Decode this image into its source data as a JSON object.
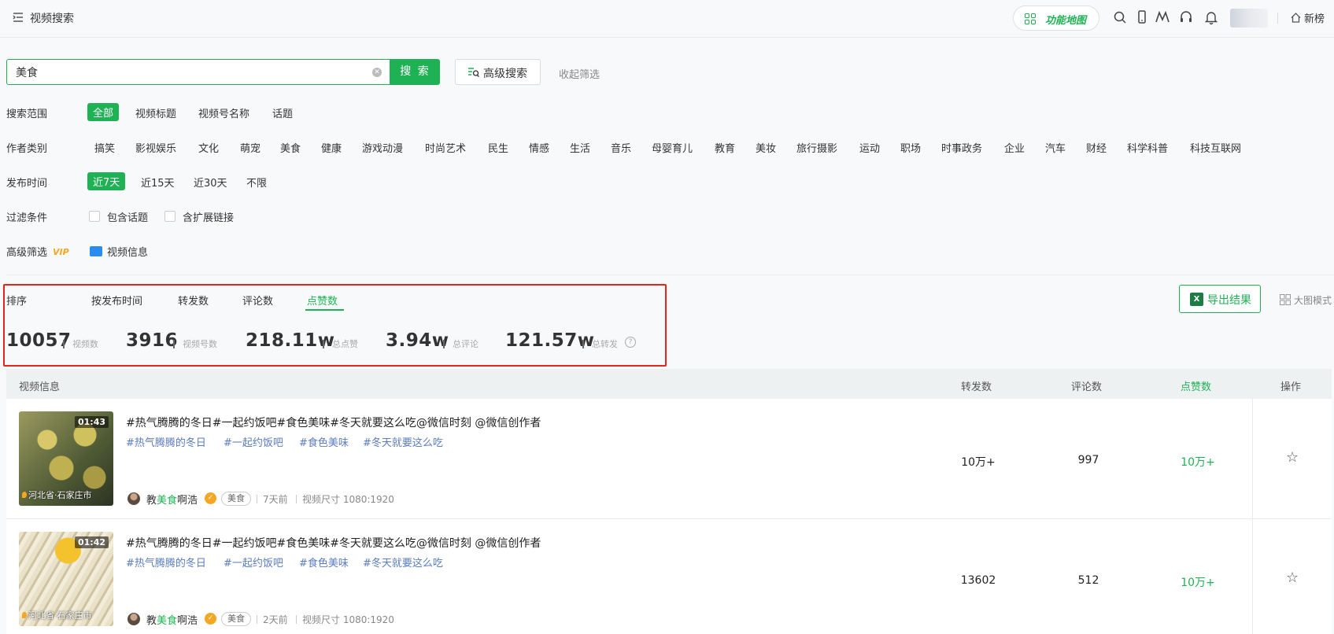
{
  "header": {
    "title": "视频搜索",
    "func_map": "功能地图",
    "xinbang": "新榜",
    "icons": [
      "search-icon",
      "mobile-icon",
      "chart-logo-icon",
      "headset-icon",
      "bell-icon"
    ]
  },
  "search": {
    "value": "美食",
    "button": "搜 索",
    "advanced": "高级搜索",
    "collapse": "收起筛选"
  },
  "filters": {
    "scope": {
      "label": "搜索范围",
      "options": [
        "全部",
        "视频标题",
        "视频号名称",
        "话题"
      ],
      "active": "全部"
    },
    "author": {
      "label": "作者类别",
      "options": [
        "搞笑",
        "影视娱乐",
        "文化",
        "萌宠",
        "美食",
        "健康",
        "游戏动漫",
        "时尚艺术",
        "民生",
        "情感",
        "生活",
        "音乐",
        "母婴育儿",
        "教育",
        "美妆",
        "旅行摄影",
        "运动",
        "职场",
        "时事政务",
        "企业",
        "汽车",
        "财经",
        "科学科普",
        "科技互联网"
      ]
    },
    "time": {
      "label": "发布时间",
      "options": [
        "近7天",
        "近15天",
        "近30天",
        "不限"
      ],
      "active": "近7天"
    },
    "condition": {
      "label": "过滤条件",
      "options": [
        "包含话题",
        "含扩展链接"
      ]
    },
    "advanced": {
      "label": "高级筛选",
      "vip": "VIP",
      "video_info": "视频信息"
    }
  },
  "sort": {
    "label": "排序",
    "tabs": [
      "按发布时间",
      "转发数",
      "评论数",
      "点赞数"
    ],
    "active": "点赞数"
  },
  "stats": [
    {
      "value": "10057",
      "label": "视频数"
    },
    {
      "value": "3916",
      "label": "视频号数"
    },
    {
      "value": "218.11w",
      "label": "总点赞"
    },
    {
      "value": "3.94w",
      "label": "总评论"
    },
    {
      "value": "121.57w",
      "label": "总转发"
    }
  ],
  "export": "导出结果",
  "big_mode": "大图模式",
  "table": {
    "headers": {
      "info": "视频信息",
      "share": "转发数",
      "comment": "评论数",
      "like": "点赞数",
      "action": "操作"
    },
    "rows": [
      {
        "duration": "01:43",
        "location": "河北省·石家庄市",
        "title": "#热气腾腾的冬日#一起约饭吧#食色美味#冬天就要这么吃@微信时刻 @微信创作者",
        "tags": [
          "#热气腾腾的冬日",
          "#一起约饭吧",
          "#食色美味",
          "#冬天就要这么吃"
        ],
        "author_pre": "教",
        "author_hl": "美食",
        "author_post": "啊浩",
        "category": "美食",
        "time": "7天前",
        "size": "视频尺寸 1080:1920",
        "share": "10万+",
        "comment": "997",
        "like": "10万+"
      },
      {
        "duration": "01:42",
        "location": "河北省·石家庄市",
        "title": "#热气腾腾的冬日#一起约饭吧#食色美味#冬天就要这么吃@微信时刻 @微信创作者",
        "tags": [
          "#热气腾腾的冬日",
          "#一起约饭吧",
          "#食色美味",
          "#冬天就要这么吃"
        ],
        "author_pre": "教",
        "author_hl": "美食",
        "author_post": "啊浩",
        "category": "美食",
        "time": "2天前",
        "size": "视频尺寸 1080:1920",
        "share": "13602",
        "comment": "512",
        "like": "10万+"
      }
    ]
  },
  "colors": {
    "accent": "#1fb254",
    "highlight_box": "#e8231a",
    "tag": "#5a7cc0"
  }
}
